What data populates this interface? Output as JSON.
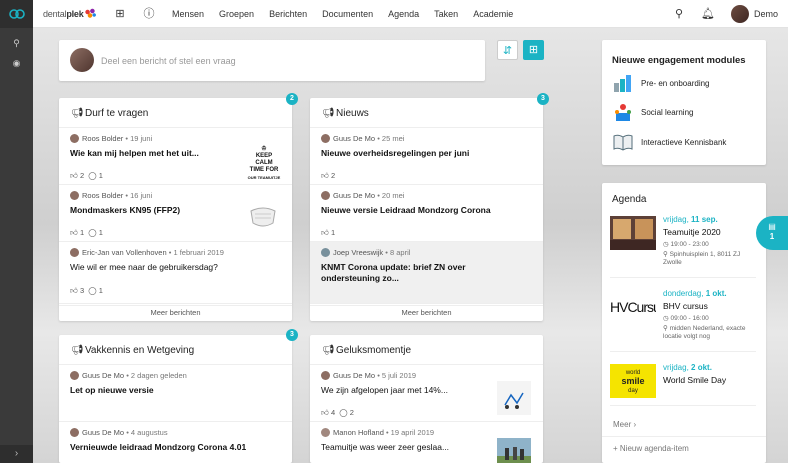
{
  "brand": {
    "prefix": "dental",
    "name": "plek"
  },
  "nav": [
    "Mensen",
    "Groepen",
    "Berichten",
    "Documenten",
    "Agenda",
    "Taken",
    "Academie"
  ],
  "user": {
    "name": "Demo"
  },
  "composer": {
    "placeholder": "Deel een bericht of stel een vraag"
  },
  "cards": [
    {
      "title": "Durf te vragen",
      "badge": "2",
      "items": [
        {
          "author": "Roos Bolder",
          "date": "19 juni",
          "text": "Wie kan mij helpen met het uit...",
          "likes": "2",
          "comments": "1",
          "thumb": "keepcalm"
        },
        {
          "author": "Roos Bolder",
          "date": "16 juni",
          "text": "Mondmaskers KN95 (FFP2)",
          "likes": "1",
          "comments": "1",
          "thumb": "mask"
        },
        {
          "author": "Eric-Jan van Vollenhoven",
          "date": "1 februari 2019",
          "text": "Wie wil er mee naar de gebruikersdag?",
          "likes": "3",
          "comments": "1"
        }
      ],
      "more": "Meer berichten"
    },
    {
      "title": "Nieuws",
      "badge": "3",
      "items": [
        {
          "author": "Guus De Mo",
          "date": "25 mei",
          "text": "Nieuwe overheidsregelingen per juni",
          "likes": "2"
        },
        {
          "author": "Guus De Mo",
          "date": "20 mei",
          "text": "Nieuwe versie Leidraad Mondzorg Corona",
          "likes": "1"
        },
        {
          "author": "Joep Vreeswijk",
          "date": "8 april",
          "text": "KNMT Corona update: brief ZN over ondersteuning zo..."
        }
      ],
      "more": "Meer berichten"
    },
    {
      "title": "Vakkennis en Wetgeving",
      "badge": "3",
      "items": [
        {
          "author": "Guus De Mo",
          "date": "2 dagen geleden",
          "text": "Let op nieuwe versie"
        },
        {
          "author": "Guus De Mo",
          "date": "4 augustus",
          "text": "Vernieuwde leidraad Mondzorg Corona 4.01"
        }
      ]
    },
    {
      "title": "Geluksmomentje",
      "items": [
        {
          "author": "Guus De Mo",
          "date": "5 juli 2019",
          "text": "We zijn afgelopen jaar met 14%...",
          "likes": "4",
          "comments": "2"
        },
        {
          "author": "Manon Hofland",
          "date": "19 april 2019",
          "text": "Teamuitje was weer zeer geslaa..."
        }
      ]
    }
  ],
  "keepcalm": {
    "l1": "KEEP",
    "l2": "CALM",
    "l3": "TIME FOR",
    "l4": "OUR TEAMUITJE"
  },
  "engagement": {
    "title": "Nieuwe engagement modules",
    "items": [
      "Pre- en onboarding",
      "Social learning",
      "Interactieve Kennisbank"
    ]
  },
  "agenda": {
    "title": "Agenda",
    "items": [
      {
        "day": "vrijdag,",
        "date": "11 sep.",
        "title": "Teamuitje 2020",
        "time": "19:00 - 23:00",
        "place": "Spinhuisplein 1, 8011 ZJ",
        "place2": "Zwolle"
      },
      {
        "day": "donderdag,",
        "date": "1 okt.",
        "title": "BHV cursus",
        "time": "09:00 - 16:00",
        "place": "midden Nederland, exacte",
        "place2": "locatie volgt nog",
        "logo": "HVCursu"
      },
      {
        "day": "vrijdag,",
        "date": "2 okt.",
        "title": "World Smile Day",
        "logo1": "world",
        "logo2": "smile",
        "logo3": "day"
      }
    ],
    "more": "Meer",
    "new": "Nieuw agenda-item"
  },
  "float_count": "1",
  "colors": {
    "accent": "#1bb3c4"
  }
}
